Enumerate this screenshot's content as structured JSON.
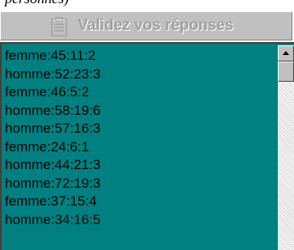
{
  "header_text": "personnes)",
  "button": {
    "label": "Validez vos réponses",
    "icon": "clipboard-icon"
  },
  "list": {
    "items": [
      "femme:45:11:2",
      "homme:52:23:3",
      "femme:46:5:2",
      "homme:58:19:6",
      "homme:57:16:3",
      "femme:24:6:1",
      "homme:44:21:3",
      "homme:72:19:3",
      "femme:37:15:4",
      "homme:34:16:5"
    ]
  },
  "colors": {
    "list_background": "#008080",
    "button_background": "#c0c0c0",
    "button_text_disabled": "#a0a0a0"
  }
}
